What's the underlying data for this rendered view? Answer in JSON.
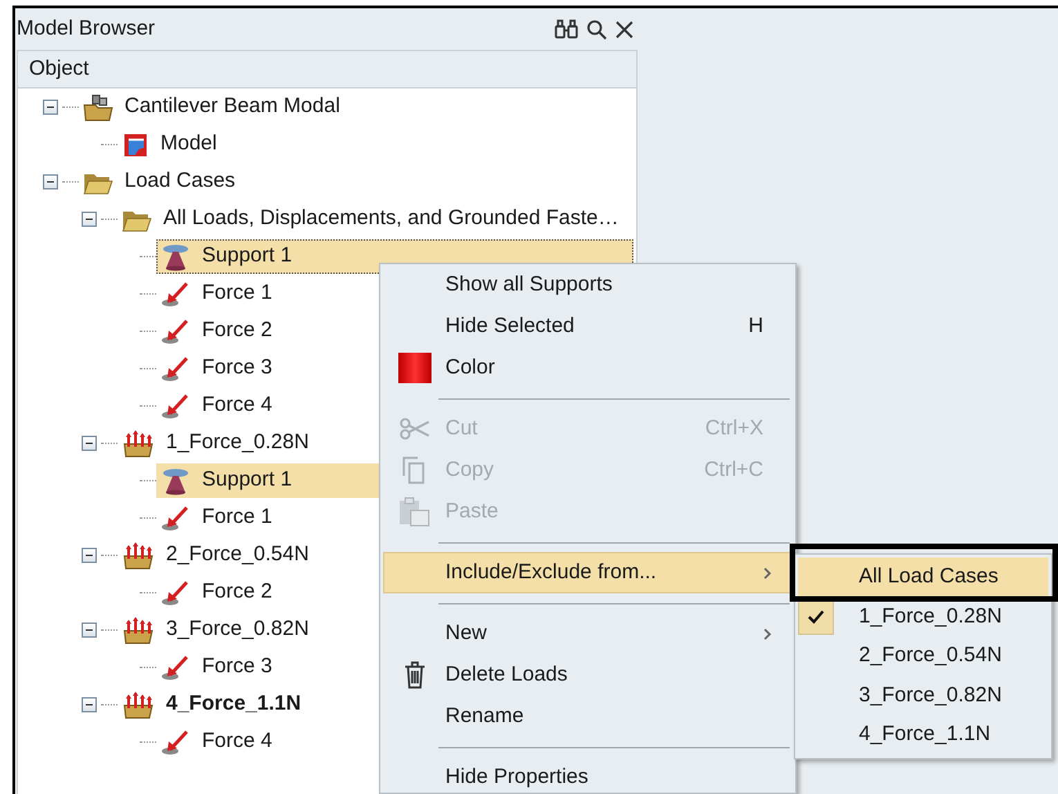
{
  "panel": {
    "title": "Model Browser"
  },
  "tree": {
    "column": "Object",
    "items": [
      {
        "label": "Cantilever Beam Modal",
        "kind": "assembly",
        "expanded": true,
        "children": [
          {
            "label": "Model",
            "kind": "model"
          }
        ]
      },
      {
        "label": "Load Cases",
        "kind": "folder",
        "expanded": true,
        "children": [
          {
            "label": "All Loads, Displacements, and Grounded Faste…",
            "kind": "folder",
            "expanded": true,
            "children": [
              {
                "label": "Support 1",
                "kind": "support",
                "selected": true,
                "focused": true
              },
              {
                "label": "Force 1",
                "kind": "force",
                "selected": false
              },
              {
                "label": "Force 2",
                "kind": "force",
                "selected": false
              },
              {
                "label": "Force 3",
                "kind": "force",
                "selected": false
              },
              {
                "label": "Force 4",
                "kind": "force",
                "selected": false
              }
            ]
          },
          {
            "label": "1_Force_0.28N",
            "kind": "loadcase",
            "expanded": true,
            "active": false,
            "children": [
              {
                "label": "Support 1",
                "kind": "support",
                "selected": true,
                "focused": false
              },
              {
                "label": "Force 1",
                "kind": "force",
                "selected": false
              }
            ]
          },
          {
            "label": "2_Force_0.54N",
            "kind": "loadcase",
            "expanded": true,
            "active": false,
            "children": [
              {
                "label": "Force 2",
                "kind": "force",
                "selected": false
              }
            ]
          },
          {
            "label": "3_Force_0.82N",
            "kind": "loadcase",
            "expanded": true,
            "active": false,
            "children": [
              {
                "label": "Force 3",
                "kind": "force",
                "selected": false
              }
            ]
          },
          {
            "label": "4_Force_1.1N",
            "kind": "loadcase",
            "expanded": true,
            "active": true,
            "children": [
              {
                "label": "Force 4",
                "kind": "force",
                "selected": false
              }
            ]
          }
        ]
      }
    ]
  },
  "context_menu": [
    {
      "kind": "plain",
      "label": "Show all Supports",
      "disabled": false,
      "selected": false
    },
    {
      "kind": "plain",
      "label": "Hide Selected",
      "shortcut": "H",
      "disabled": false,
      "selected": false
    },
    {
      "kind": "swatch",
      "label": "Color",
      "disabled": false,
      "selected": false
    },
    {
      "kind": "separator"
    },
    {
      "kind": "scissors",
      "label": "Cut",
      "shortcut": "Ctrl+X",
      "disabled": true,
      "selected": false
    },
    {
      "kind": "copy",
      "label": "Copy",
      "shortcut": "Ctrl+C",
      "disabled": true,
      "selected": false
    },
    {
      "kind": "paste",
      "label": "Paste",
      "disabled": true,
      "selected": false
    },
    {
      "kind": "separator"
    },
    {
      "kind": "plain",
      "label": "Include/Exclude from...",
      "submenu": true,
      "disabled": false,
      "selected": true
    },
    {
      "kind": "separator"
    },
    {
      "kind": "plain",
      "label": "New",
      "submenu": true,
      "disabled": false,
      "selected": false
    },
    {
      "kind": "trash",
      "label": "Delete Loads",
      "disabled": false,
      "selected": false
    },
    {
      "kind": "plain",
      "label": "Rename",
      "disabled": false,
      "selected": false
    },
    {
      "kind": "separator"
    },
    {
      "kind": "plain",
      "label": "Hide Properties",
      "disabled": false,
      "selected": false
    }
  ],
  "submenu": [
    {
      "label": "All Load Cases",
      "selected": true,
      "checked": false
    },
    {
      "label": "1_Force_0.28N",
      "selected": false,
      "checked": true
    },
    {
      "label": "2_Force_0.54N",
      "selected": false,
      "checked": false
    },
    {
      "label": "3_Force_0.82N",
      "selected": false,
      "checked": false
    },
    {
      "label": "4_Force_1.1N",
      "selected": false,
      "checked": false
    }
  ]
}
